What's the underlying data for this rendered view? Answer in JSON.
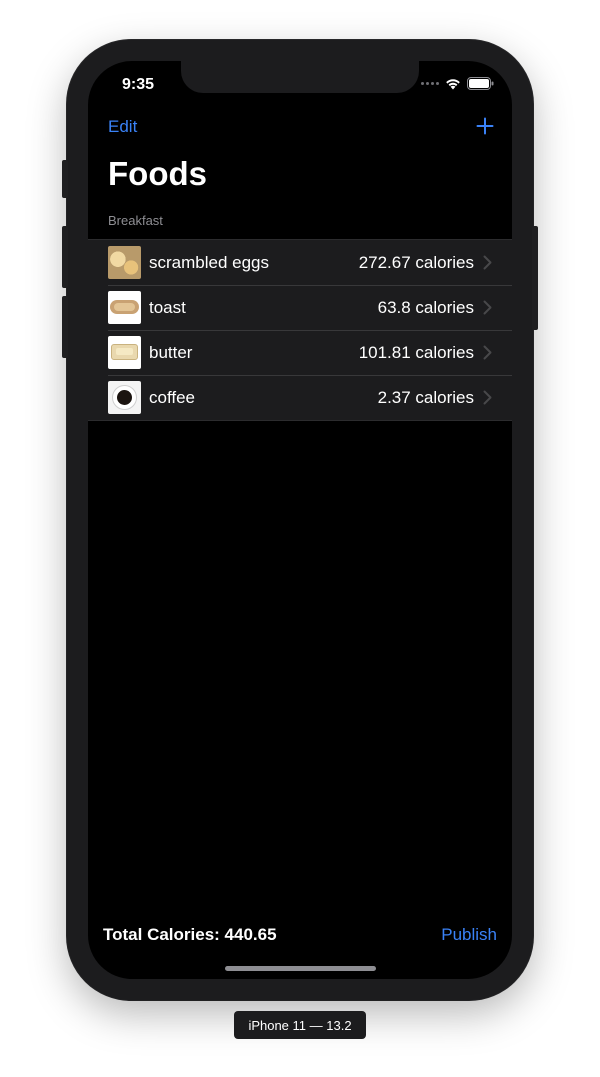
{
  "status_bar": {
    "time": "9:35"
  },
  "nav": {
    "edit_label": "Edit",
    "add_label": "+"
  },
  "page": {
    "title": "Foods"
  },
  "section": {
    "header": "Breakfast"
  },
  "foods": [
    {
      "name": "scrambled eggs",
      "calories": "272.67 calories",
      "icon": "scrambled-eggs-thumbnail"
    },
    {
      "name": "toast",
      "calories": "63.8 calories",
      "icon": "toast-thumbnail"
    },
    {
      "name": "butter",
      "calories": "101.81 calories",
      "icon": "butter-thumbnail"
    },
    {
      "name": "coffee",
      "calories": "2.37 calories",
      "icon": "coffee-thumbnail"
    }
  ],
  "footer": {
    "total": "Total Calories: 440.65",
    "publish_label": "Publish"
  },
  "device_label": "iPhone 11 — 13.2",
  "colors": {
    "accent": "#3a82f7",
    "background": "#000000",
    "cell": "#1c1c1e"
  }
}
